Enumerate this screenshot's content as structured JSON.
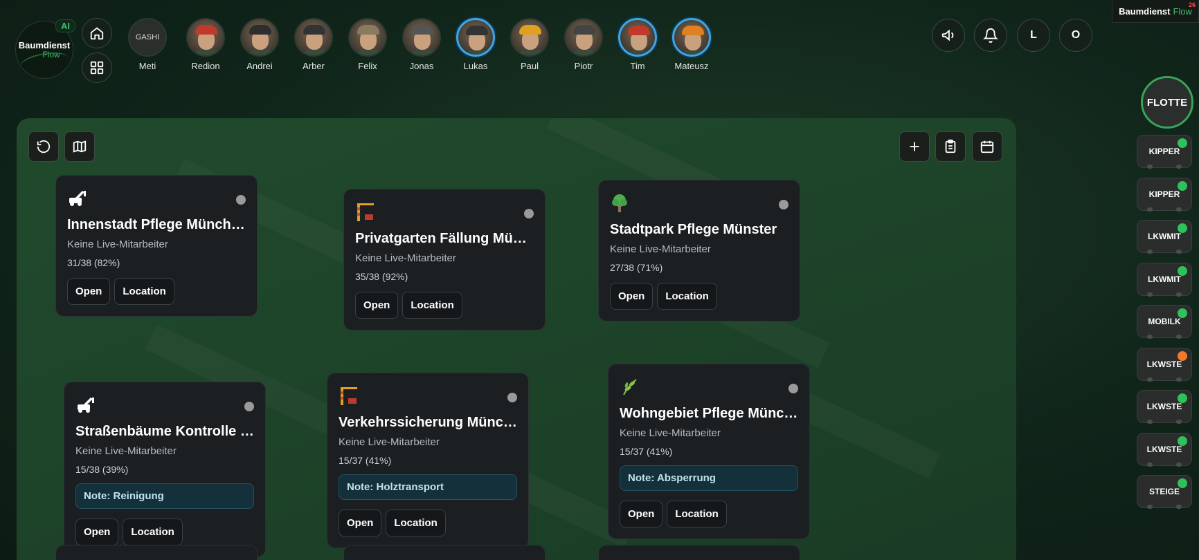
{
  "app": {
    "logo_line1": "Baumdienst",
    "logo_line2": "Flow",
    "ai_badge": "AI",
    "brand_name": "Baumdienst",
    "brand_flow": "Flow",
    "brand_count": "26"
  },
  "workers": [
    {
      "name": "Meti",
      "avatar_text": "GASHI",
      "active": false,
      "helmet": "#000000"
    },
    {
      "name": "Redion",
      "active": false,
      "helmet": "#c0392b"
    },
    {
      "name": "Andrei",
      "active": false,
      "helmet": "#2d2d2d"
    },
    {
      "name": "Arber",
      "active": false,
      "helmet": "#333333"
    },
    {
      "name": "Felix",
      "active": false,
      "helmet": "#8a7a60"
    },
    {
      "name": "Jonas",
      "active": false,
      "helmet": "#555555"
    },
    {
      "name": "Lukas",
      "active": true,
      "helmet": "#333333"
    },
    {
      "name": "Paul",
      "active": false,
      "helmet": "#e0a020"
    },
    {
      "name": "Piotr",
      "active": false,
      "helmet": "#444444"
    },
    {
      "name": "Tim",
      "active": true,
      "helmet": "#c0392b"
    },
    {
      "name": "Mateusz",
      "active": true,
      "helmet": "#e08020"
    }
  ],
  "user_initials": [
    "L",
    "O"
  ],
  "sites": [
    {
      "icon": "crane",
      "title": "Innenstadt Pflege München",
      "sub": "Keine Live-Mitarbeiter",
      "count": "31/38 (82%)",
      "note": "",
      "open": "Open",
      "location": "Location"
    },
    {
      "icon": "tower",
      "title": "Privatgarten Fällung Münster",
      "sub": "Keine Live-Mitarbeiter",
      "count": "35/38 (92%)",
      "note": "",
      "open": "Open",
      "location": "Location"
    },
    {
      "icon": "tree",
      "title": "Stadtpark Pflege Münster",
      "sub": "Keine Live-Mitarbeiter",
      "count": "27/38 (71%)",
      "note": "",
      "open": "Open",
      "location": "Location"
    },
    {
      "icon": "crane",
      "title": "Straßenbäume Kontrolle München",
      "sub": "Keine Live-Mitarbeiter",
      "count": "15/38 (39%)",
      "note": "Note: Reinigung",
      "open": "Open",
      "location": "Location"
    },
    {
      "icon": "tower",
      "title": "Verkehrssicherung München",
      "sub": "Keine Live-Mitarbeiter",
      "count": "15/37 (41%)",
      "note": "Note: Holztransport",
      "open": "Open",
      "location": "Location"
    },
    {
      "icon": "herb",
      "title": "Wohngebiet Pflege München",
      "sub": "Keine Live-Mitarbeiter",
      "count": "15/37 (41%)",
      "note": "Note: Absperrung",
      "open": "Open",
      "location": "Location"
    }
  ],
  "fleet": {
    "label": "FLOTTE",
    "vehicles": [
      {
        "name": "KIPPER",
        "status_color": "#2fc25a"
      },
      {
        "name": "KIPPER",
        "status_color": "#2fc25a"
      },
      {
        "name": "LKWMIT",
        "status_color": "#2fc25a"
      },
      {
        "name": "LKWMIT",
        "status_color": "#2fc25a"
      },
      {
        "name": "MOBILK",
        "status_color": "#2fc25a"
      },
      {
        "name": "LKWSTE",
        "status_color": "#f07a2a"
      },
      {
        "name": "LKWSTE",
        "status_color": "#2fc25a"
      },
      {
        "name": "LKWSTE",
        "status_color": "#2fc25a"
      },
      {
        "name": "STEIGE",
        "status_color": "#2fc25a"
      }
    ]
  }
}
